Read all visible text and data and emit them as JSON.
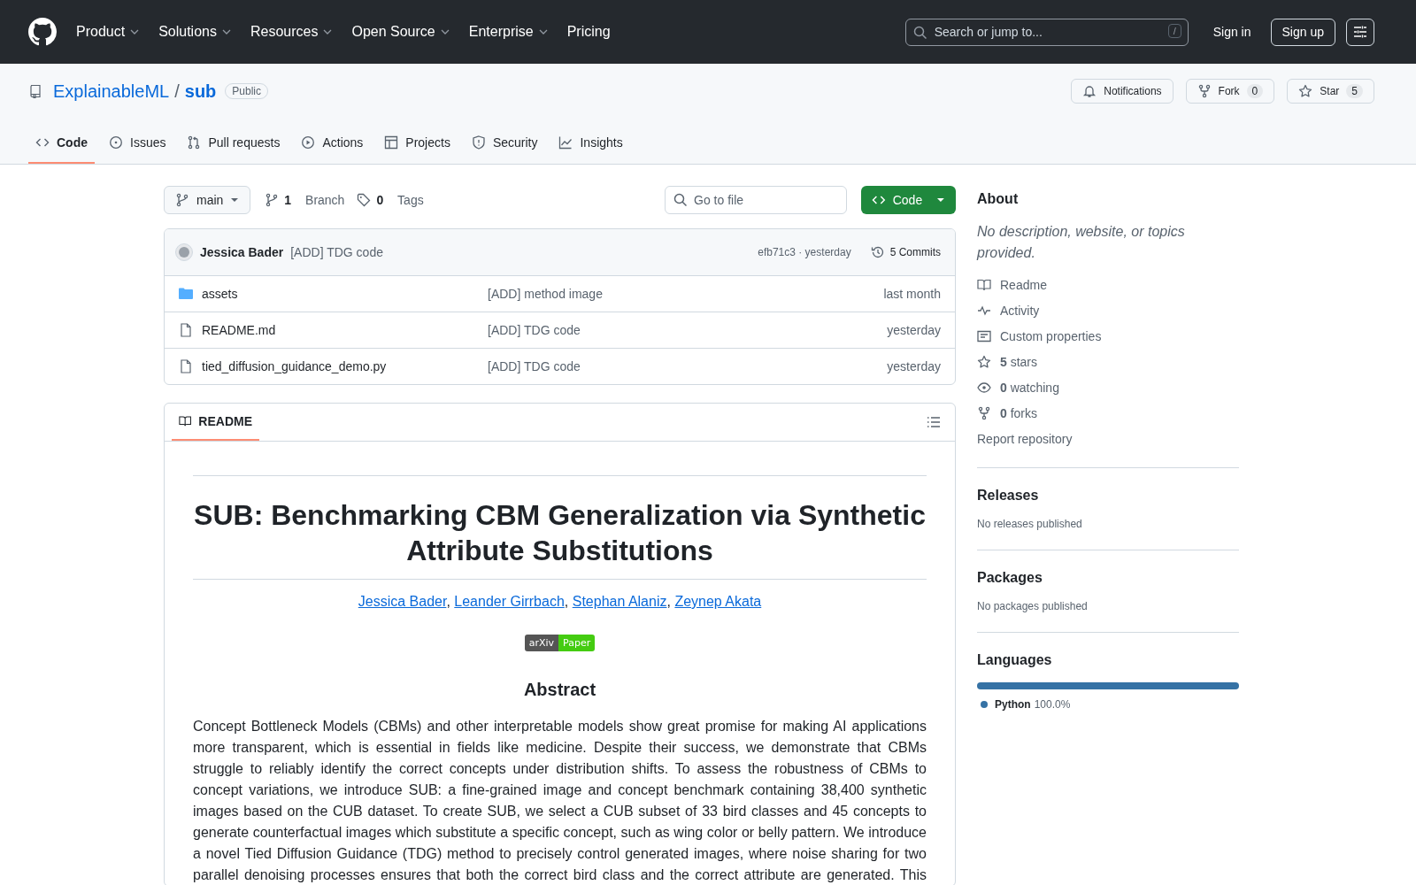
{
  "header": {
    "nav": [
      {
        "label": "Product",
        "dropdown": true
      },
      {
        "label": "Solutions",
        "dropdown": true
      },
      {
        "label": "Resources",
        "dropdown": true
      },
      {
        "label": "Open Source",
        "dropdown": true
      },
      {
        "label": "Enterprise",
        "dropdown": true
      },
      {
        "label": "Pricing",
        "dropdown": false
      }
    ],
    "search": {
      "placeholder": "Search or jump to...",
      "shortcut": "/"
    },
    "sign_in": "Sign in",
    "sign_up": "Sign up"
  },
  "repo": {
    "owner": "ExplainableML",
    "separator": "/",
    "name": "sub",
    "visibility": "Public",
    "actions": [
      {
        "kind": "bell",
        "label": "Notifications"
      },
      {
        "kind": "fork",
        "label": "Fork",
        "count": "0"
      },
      {
        "kind": "star",
        "label": "Star",
        "count": "5"
      }
    ],
    "tabs": [
      {
        "kind": "code",
        "label": "Code",
        "selected": true
      },
      {
        "kind": "issue",
        "label": "Issues",
        "selected": false
      },
      {
        "kind": "pr",
        "label": "Pull requests",
        "selected": false
      },
      {
        "kind": "play",
        "label": "Actions",
        "selected": false
      },
      {
        "kind": "table",
        "label": "Projects",
        "selected": false
      },
      {
        "kind": "shield",
        "label": "Security",
        "selected": false
      },
      {
        "kind": "graph",
        "label": "Insights",
        "selected": false
      }
    ]
  },
  "toolbar": {
    "branch": "main",
    "branches_count": "1",
    "branches_label": "Branch",
    "tags_count": "0",
    "tags_label": "Tags",
    "go_to_file": {
      "placeholder": "Go to file"
    },
    "code_button": "Code"
  },
  "commit": {
    "author": "Jessica Bader",
    "message": "[ADD] TDG code",
    "meta": "efb71c3 · yesterday",
    "commits": "5 Commits"
  },
  "files": [
    {
      "kind": "folder",
      "name": "assets",
      "message": "[ADD] method image",
      "time": "last month"
    },
    {
      "kind": "file",
      "name": "README.md",
      "message": "[ADD] TDG code",
      "time": "yesterday"
    },
    {
      "kind": "file",
      "name": "tied_diffusion_guidance_demo.py",
      "message": "[ADD] TDG code",
      "time": "yesterday"
    }
  ],
  "readme": {
    "tab": "README",
    "title": "SUB: Benchmarking CBM Generalization via Synthetic Attribute Substitutions",
    "authors": [
      "Jessica Bader",
      "Leander Girrbach",
      "Stephan Alaniz",
      "Zeynep Akata"
    ],
    "author_separator": ",",
    "badge": {
      "left": "arXiv",
      "right": "Paper"
    },
    "abstract_heading": "Abstract",
    "abstract": "Concept Bottleneck Models (CBMs) and other interpretable models show great promise for making AI applications more transparent, which is essential in fields like medicine. Despite their success, we demonstrate that CBMs struggle to reliably identify the correct concepts under distribution shifts. To assess the robustness of CBMs to concept variations, we introduce SUB: a fine-grained image and concept benchmark containing 38,400 synthetic images based on the CUB dataset. To create SUB, we select a CUB subset of 33 bird classes and 45 concepts to generate counterfactual images which substitute a specific concept, such as wing color or belly pattern. We introduce a novel Tied Diffusion Guidance (TDG) method to precisely control generated images, where noise sharing for two parallel denoising processes ensures that both the correct bird class and the correct attribute are generated. This"
  },
  "sidebar": {
    "about_title": "About",
    "description": "No description, website, or topics provided.",
    "links": [
      {
        "kind": "book",
        "label": "Readme"
      },
      {
        "kind": "pulse",
        "label": "Activity"
      },
      {
        "kind": "note",
        "label": "Custom properties"
      },
      {
        "kind": "star",
        "count": "5",
        "label": "stars"
      },
      {
        "kind": "eye",
        "count": "0",
        "label": "watching"
      },
      {
        "kind": "fork",
        "count": "0",
        "label": "forks"
      },
      {
        "kind": "plain",
        "label": "Report repository"
      }
    ],
    "releases": {
      "title": "Releases",
      "text": "No releases published"
    },
    "packages": {
      "title": "Packages",
      "text": "No packages published"
    },
    "languages": {
      "title": "Languages",
      "items": [
        {
          "name": "Python",
          "percent": "100.0%",
          "color": "#3572a5",
          "level": 1
        }
      ]
    }
  }
}
